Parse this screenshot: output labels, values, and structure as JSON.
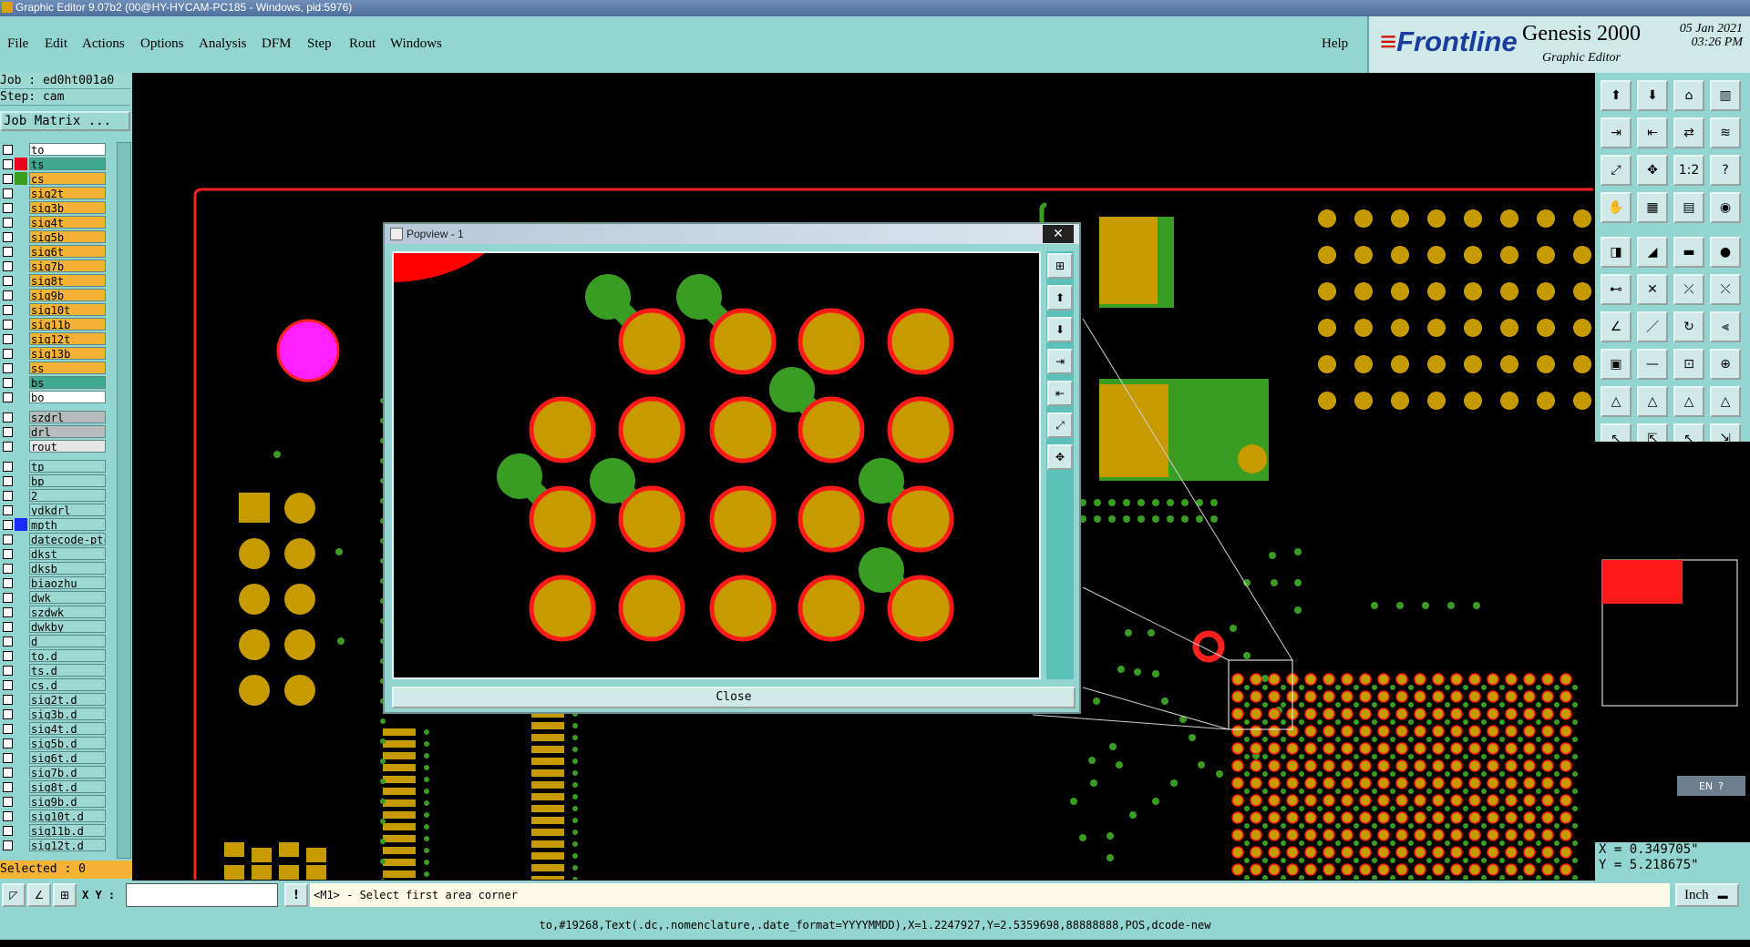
{
  "window": {
    "title": "Graphic Editor 9.07b2 (00@HY-HYCAM-PC185 - Windows, pid:5976)"
  },
  "menu": {
    "items": [
      "File",
      "Edit",
      "Actions",
      "Options",
      "Analysis",
      "DFM",
      "Step",
      "Rout",
      "Windows"
    ],
    "help": "Help"
  },
  "brand": {
    "logo_text": "Frontline",
    "product": "Genesis 2000",
    "subtitle": "Graphic Editor",
    "date": "05 Jan 2021",
    "time": "03:26 PM"
  },
  "job": {
    "job_line": "Job : ed0ht001a0",
    "step_line": "Step: cam",
    "matrix_button": "Job Matrix ..."
  },
  "layers": [
    {
      "name": "to",
      "color": "#ffffff",
      "swatch": "",
      "checked": true
    },
    {
      "name": "ts",
      "color": "#3fa98f",
      "swatch": "#e8001c",
      "checked": true,
      "selected": true
    },
    {
      "name": "cs",
      "color": "#f5b335",
      "swatch": "#3a9d23",
      "checked": true
    },
    {
      "name": "sig2t",
      "color": "#f5b335",
      "swatch": "",
      "checked": false
    },
    {
      "name": "sig3b",
      "color": "#f5b335",
      "swatch": "",
      "checked": false
    },
    {
      "name": "sig4t",
      "color": "#f5b335",
      "swatch": "",
      "checked": false
    },
    {
      "name": "sig5b",
      "color": "#f5b335",
      "swatch": "",
      "checked": false
    },
    {
      "name": "sig6t",
      "color": "#f5b335",
      "swatch": "",
      "checked": false
    },
    {
      "name": "sig7b",
      "color": "#f5b335",
      "swatch": "",
      "checked": false
    },
    {
      "name": "sig8t",
      "color": "#f5b335",
      "swatch": "",
      "checked": false
    },
    {
      "name": "sig9b",
      "color": "#f5b335",
      "swatch": "",
      "checked": false
    },
    {
      "name": "sig10t",
      "color": "#f5b335",
      "swatch": "",
      "checked": false
    },
    {
      "name": "sig11b",
      "color": "#f5b335",
      "swatch": "",
      "checked": false
    },
    {
      "name": "sig12t",
      "color": "#f5b335",
      "swatch": "",
      "checked": false
    },
    {
      "name": "sig13b",
      "color": "#f5b335",
      "swatch": "",
      "checked": false
    },
    {
      "name": "ss",
      "color": "#f5b335",
      "swatch": "",
      "checked": false
    },
    {
      "name": "bs",
      "color": "#3fa98f",
      "swatch": "",
      "checked": false
    },
    {
      "name": "bo",
      "color": "#ffffff",
      "swatch": "",
      "checked": false
    },
    {
      "name": "",
      "color": "",
      "swatch": "",
      "separator": true
    },
    {
      "name": "szdrl",
      "color": "#b5bcbc",
      "swatch": "",
      "checked": false
    },
    {
      "name": "drl",
      "color": "#b5bcbc",
      "swatch": "",
      "checked": false
    },
    {
      "name": "rout",
      "color": "#e6e6e6",
      "swatch": "",
      "checked": false
    },
    {
      "name": "",
      "color": "",
      "swatch": "",
      "separator": true
    },
    {
      "name": "tp",
      "color": "#9ed8d3",
      "swatch": "",
      "checked": false
    },
    {
      "name": "bp",
      "color": "#9ed8d3",
      "swatch": "",
      "checked": false
    },
    {
      "name": "2",
      "color": "#9ed8d3",
      "swatch": "",
      "checked": false
    },
    {
      "name": "ydkdrl",
      "color": "#9ed8d3",
      "swatch": "",
      "checked": false
    },
    {
      "name": "mpth",
      "color": "#9ed8d3",
      "swatch": "#1a2cff",
      "checked": false
    },
    {
      "name": "datecode-ptc",
      "color": "#9ed8d3",
      "swatch": "",
      "checked": false
    },
    {
      "name": "dkst",
      "color": "#9ed8d3",
      "swatch": "",
      "checked": false
    },
    {
      "name": "dksb",
      "color": "#9ed8d3",
      "swatch": "",
      "checked": false
    },
    {
      "name": "biaozhu",
      "color": "#9ed8d3",
      "swatch": "",
      "checked": false
    },
    {
      "name": "dwk",
      "color": "#9ed8d3",
      "swatch": "",
      "checked": false
    },
    {
      "name": "szdwk",
      "color": "#9ed8d3",
      "swatch": "",
      "checked": false
    },
    {
      "name": "dwkby",
      "color": "#9ed8d3",
      "swatch": "",
      "checked": false
    },
    {
      "name": "d",
      "color": "#9ed8d3",
      "swatch": "",
      "checked": false
    },
    {
      "name": "to.d",
      "color": "#9ed8d3",
      "swatch": "",
      "checked": false
    },
    {
      "name": "ts.d",
      "color": "#9ed8d3",
      "swatch": "",
      "checked": false
    },
    {
      "name": "cs.d",
      "color": "#9ed8d3",
      "swatch": "",
      "checked": false
    },
    {
      "name": "sig2t.d",
      "color": "#9ed8d3",
      "swatch": "",
      "checked": false
    },
    {
      "name": "sig3b.d",
      "color": "#9ed8d3",
      "swatch": "",
      "checked": false
    },
    {
      "name": "sig4t.d",
      "color": "#9ed8d3",
      "swatch": "",
      "checked": false
    },
    {
      "name": "sig5b.d",
      "color": "#9ed8d3",
      "swatch": "",
      "checked": false
    },
    {
      "name": "sig6t.d",
      "color": "#9ed8d3",
      "swatch": "",
      "checked": false
    },
    {
      "name": "sig7b.d",
      "color": "#9ed8d3",
      "swatch": "",
      "checked": false
    },
    {
      "name": "sig8t.d",
      "color": "#9ed8d3",
      "swatch": "",
      "checked": false
    },
    {
      "name": "sig9b.d",
      "color": "#9ed8d3",
      "swatch": "",
      "checked": false
    },
    {
      "name": "sig10t.d",
      "color": "#9ed8d3",
      "swatch": "",
      "checked": false
    },
    {
      "name": "sig11b.d",
      "color": "#9ed8d3",
      "swatch": "",
      "checked": false
    },
    {
      "name": "sig12t.d",
      "color": "#9ed8d3",
      "swatch": "",
      "checked": false
    }
  ],
  "selection": {
    "text": "Selected : 0"
  },
  "popview": {
    "title": "Popview - 1",
    "close_label": "Close",
    "close_x": "✕"
  },
  "coords": {
    "x": "X = 0.349705\"",
    "y": "Y = 5.218675\""
  },
  "lang": {
    "label": "EN"
  },
  "command": {
    "xy_label": "X Y :",
    "xy_value": "",
    "prompt": "<M1> - Select first area corner",
    "unit": "Inch"
  },
  "status": {
    "text": "to,#19268,Text(.dc,.nomenclature,.date_format=YYYYMMDD),X=1.2247927,Y=2.5359698,88888888,POS,dcode-new"
  },
  "colors": {
    "panel": "#93d5d0",
    "pad": "#c79a00",
    "pad_ring": "#ff1a1a",
    "copper": "#3a9d23",
    "outline": "#ff2020"
  },
  "toolbar_icons": [
    "layer-up-icon",
    "layer-down-icon",
    "home-icon",
    "panel-icon",
    "step-in-icon",
    "step-out-icon",
    "swap-icon",
    "snake-icon",
    "fit-icon",
    "zoom-center-icon",
    "scale-icon",
    "help-icon",
    "hand-icon",
    "grid-icon",
    "measure-icon",
    "compare-icon",
    "pad-add-icon",
    "line-add-icon",
    "ruler-icon",
    "point-icon",
    "net-icon",
    "cross-icon",
    "connect-icon",
    "link-icon",
    "angle-icon",
    "slash-icon",
    "arc-icon",
    "frame-icon",
    "square-icon",
    "minus-icon",
    "split-icon",
    "target-icon",
    "delta-icon",
    "triangle-a-icon",
    "triangle-b-icon",
    "triangle-c-icon",
    "cursor-icon",
    "cursor-box-icon",
    "cursor-red-icon",
    "cursor-net-icon"
  ]
}
